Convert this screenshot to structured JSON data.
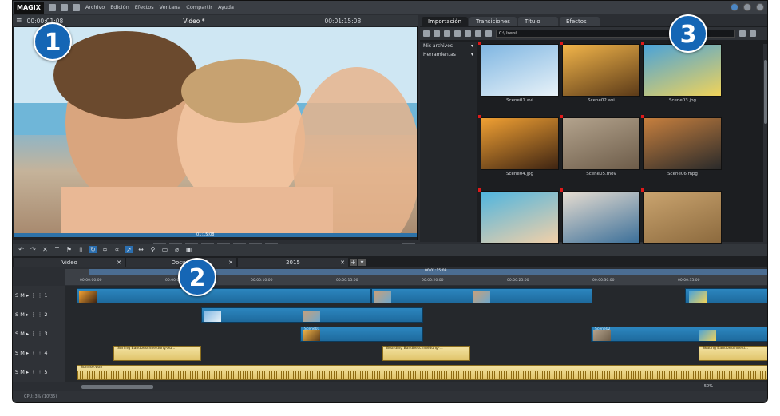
{
  "app": {
    "logo": "MAGIX"
  },
  "menu": [
    "Archivo",
    "Edición",
    "Efectos",
    "Ventana",
    "Compartir",
    "Ayuda"
  ],
  "preview": {
    "timecode_left": "00:00:01:08",
    "title": "Video *",
    "timecode_right": "00:01:15:08",
    "position_label": "01:15:08",
    "transport": [
      "[",
      "]",
      "|◂◂",
      "|◂",
      "■",
      "▸|",
      "▸▸|",
      "●"
    ]
  },
  "media": {
    "tabs": [
      "Importación",
      "Transiciones",
      "Título",
      "Efectos"
    ],
    "path": "C:\\Users\\",
    "side": [
      "Mis archivos",
      "Herramientas"
    ],
    "files": [
      {
        "name": "Scene01.avi",
        "colors": [
          "#7fb6e2",
          "#e8f2f8"
        ]
      },
      {
        "name": "Scene02.avi",
        "colors": [
          "#f2b54a",
          "#5b3a18"
        ]
      },
      {
        "name": "Scene03.jpg",
        "colors": [
          "#4aa3d9",
          "#f0d35a"
        ]
      },
      {
        "name": "Scene04.jpg",
        "colors": [
          "#f0a033",
          "#3e2412"
        ]
      },
      {
        "name": "Scene05.mov",
        "colors": [
          "#b3a38d",
          "#6d5c49"
        ]
      },
      {
        "name": "Scene06.mpg",
        "colors": [
          "#c67f3e",
          "#2a2a2a"
        ]
      },
      {
        "name": "",
        "colors": [
          "#4fb5df",
          "#f2d0a8"
        ]
      },
      {
        "name": "",
        "colors": [
          "#e7ddd1",
          "#3b6f99"
        ]
      },
      {
        "name": "",
        "colors": [
          "#caa46f",
          "#8c6a3e"
        ]
      }
    ]
  },
  "timeline": {
    "tabs": [
      "Video",
      "Docum",
      "2015"
    ],
    "ruler_top_label": "00:01:15:08",
    "ticks": [
      "00:00:00:00",
      "00:00:05:00",
      "00:00:10:00",
      "00:00:15:00",
      "00:00:20:00",
      "00:00:25:00",
      "00:00:30:00",
      "00:00:35:00"
    ],
    "tracks": [
      {
        "label": "S M ▸ ⋮ ⋮ 1"
      },
      {
        "label": "S M ▸ ⋮ ⋮ 2"
      },
      {
        "label": "S M ▸ ⋮ ⋮ 3"
      },
      {
        "label": "S M ▸ ⋮ ⋮ 4"
      },
      {
        "label": "S M ▸ ⋮ ⋮ 5"
      }
    ],
    "audio_clips": [
      "Surfing   Bandbeschneidung-Au...",
      "Boarding   Bandbeschneidung-...",
      "Skating   Bandbeschneid...",
      "Sunrise.wav"
    ],
    "video_clip_labels": [
      "Scene01",
      "Scene02"
    ],
    "zoom": "50%"
  },
  "status": "CPU: 3% (10/35)",
  "badges": [
    "1",
    "2",
    "3"
  ],
  "colors": {
    "accent": "#1566b5",
    "clip": "#2c86bf",
    "audio": "#e0c46a"
  }
}
